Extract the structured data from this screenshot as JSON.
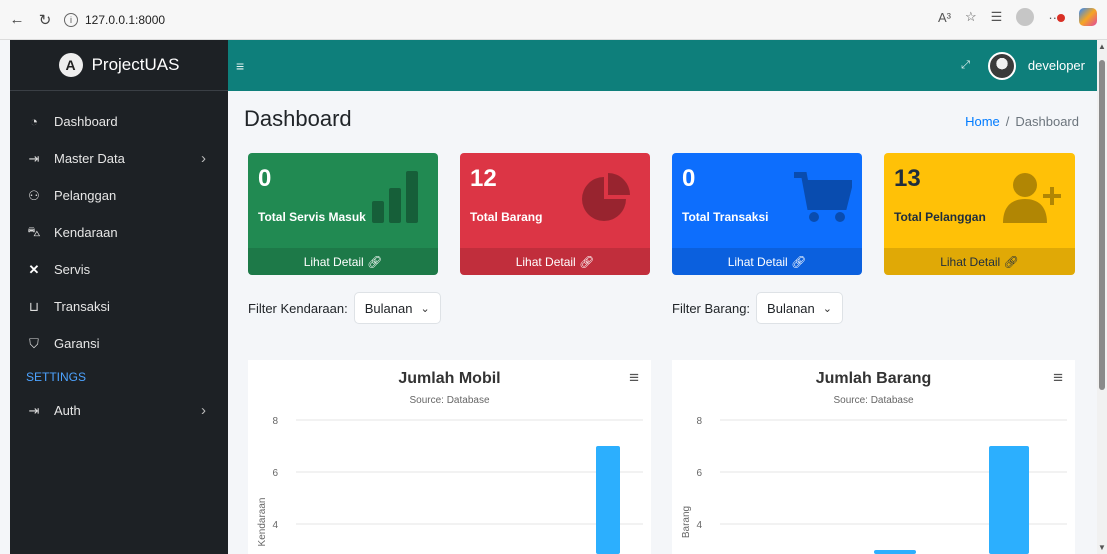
{
  "browser": {
    "url": "127.0.0.1:8000",
    "reader_icon": "A³"
  },
  "sidebar": {
    "brand": "ProjectUAS",
    "items": [
      {
        "label": "Dashboard",
        "icon": "gauge-icon"
      },
      {
        "label": "Master Data",
        "icon": "sign-in-icon"
      },
      {
        "label": "Pelanggan",
        "icon": "users-icon"
      },
      {
        "label": "Kendaraan",
        "icon": "car-icon"
      },
      {
        "label": "Servis",
        "icon": "tools-icon"
      },
      {
        "label": "Transaksi",
        "icon": "cart-icon"
      },
      {
        "label": "Garansi",
        "icon": "shield-icon"
      }
    ],
    "settings_header": "SETTINGS",
    "auth_label": "Auth"
  },
  "topbar": {
    "user_name": "developer"
  },
  "page": {
    "title": "Dashboard",
    "breadcrumb_home": "Home",
    "breadcrumb_sep": "/",
    "breadcrumb_current": "Dashboard"
  },
  "info_boxes": [
    {
      "value": "0",
      "label": "Total Servis Masuk",
      "footer": "Lihat Detail",
      "color": "#218a52",
      "icon": "bar-chart-icon"
    },
    {
      "value": "12",
      "label": "Total Barang",
      "footer": "Lihat Detail",
      "color": "#dc3545",
      "icon": "pie-chart-icon"
    },
    {
      "value": "0",
      "label": "Total Transaksi",
      "footer": "Lihat Detail",
      "color": "#0d6efd",
      "icon": "cart-icon"
    },
    {
      "value": "13",
      "label": "Total Pelanggan",
      "footer": "Lihat Detail",
      "color": "#ffc107",
      "icon": "user-plus-icon"
    }
  ],
  "filters": {
    "kendaraan": {
      "label": "Filter Kendaraan:",
      "value": "Bulanan"
    },
    "barang": {
      "label": "Filter Barang:",
      "value": "Bulanan"
    }
  },
  "chart_data": [
    {
      "type": "bar",
      "title": "Jumlah Mobil",
      "subtitle": "Source: Database",
      "ylabel": "Kendaraan",
      "ylim": [
        0,
        8
      ],
      "yticks_visible": [
        8,
        6,
        4
      ],
      "visible_bars": [
        {
          "value": 7
        }
      ],
      "color": "#2caffe"
    },
    {
      "type": "bar",
      "title": "Jumlah Barang",
      "subtitle": "Source: Database",
      "ylabel": "Barang",
      "ylim": [
        0,
        8
      ],
      "yticks_visible": [
        8,
        6,
        4
      ],
      "visible_bars": [
        {
          "value": 3
        },
        {
          "value": 7
        }
      ],
      "color": "#2caffe"
    }
  ]
}
